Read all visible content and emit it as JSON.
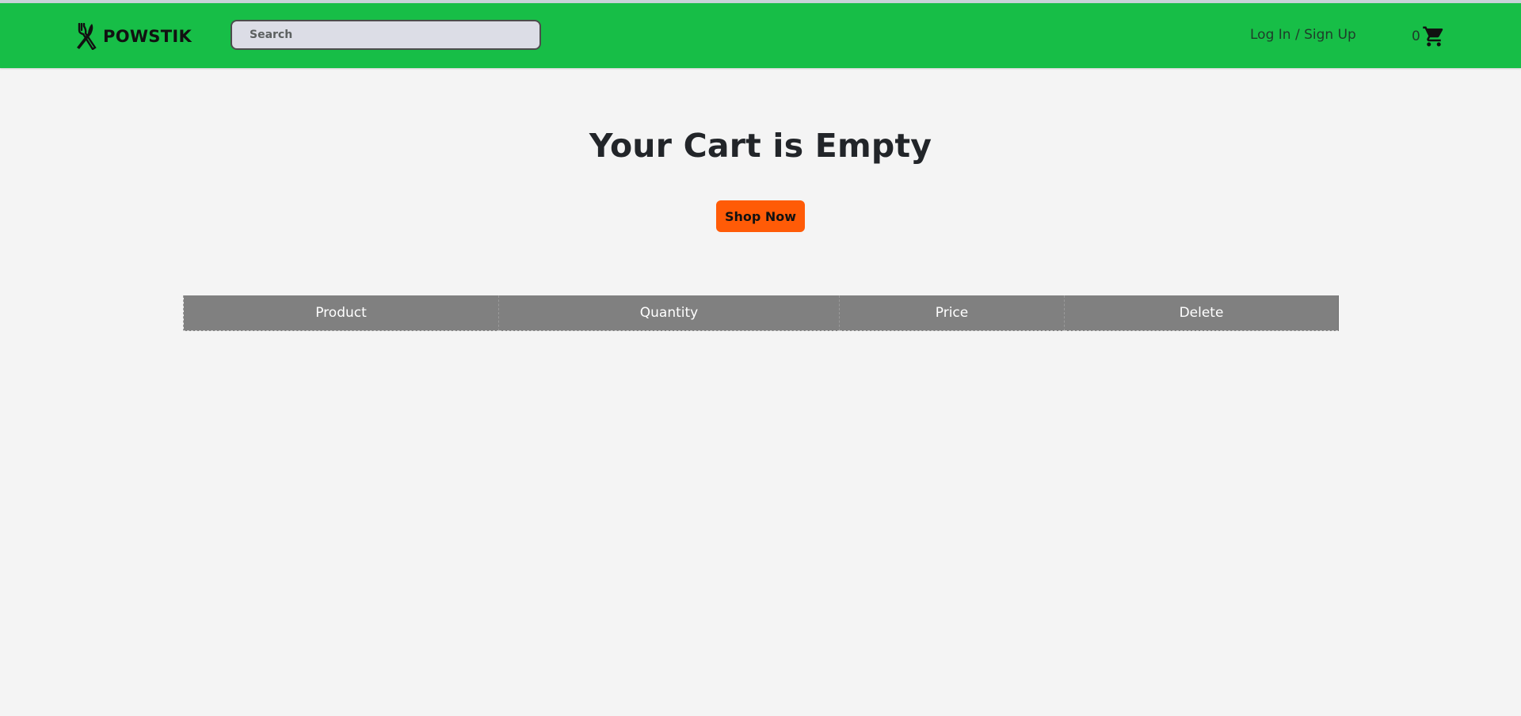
{
  "navbar": {
    "background": "#17be47",
    "logo_icon": "fork-knife-icon",
    "brand": "POWSTIK",
    "search": {
      "placeholder": "Search",
      "value": ""
    },
    "login_label": "Log In / Sign Up",
    "cart_count": "0",
    "cart_icon": "shopping-cart-icon"
  },
  "main": {
    "heading": "Your Cart is Empty",
    "shop_button": {
      "label": "Shop Now",
      "color": "#ff5b07"
    },
    "table": {
      "header_background": "#808080",
      "columns": [
        "Product",
        "Quantity",
        "Price",
        "Delete"
      ],
      "rows": []
    }
  }
}
